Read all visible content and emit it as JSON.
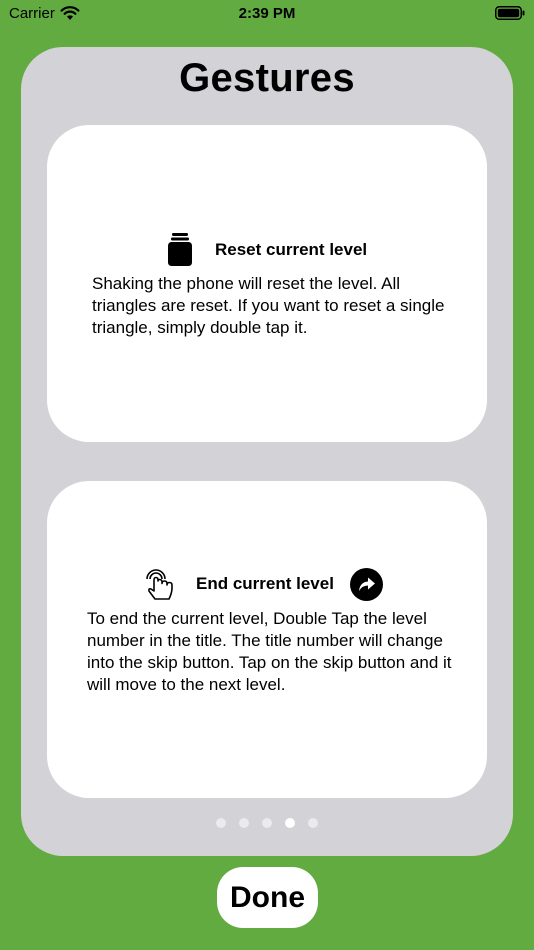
{
  "status_bar": {
    "carrier": "Carrier",
    "time": "2:39 PM"
  },
  "page": {
    "title": "Gestures"
  },
  "cards": [
    {
      "title": "Reset current level",
      "icon": "jar-icon",
      "text": "Shaking the phone will reset the level.  All triangles are reset. If you want to reset a single triangle, simply double tap it."
    },
    {
      "title": "End current level",
      "icon": "tap-hand-icon",
      "trailing_icon": "forward-arrow-icon",
      "text": "To end the current level, Double Tap the level number in the title.  The title number will change into the skip button. Tap on the skip button and it will move to the next level."
    }
  ],
  "pager": {
    "count": 5,
    "current": 4
  },
  "done_button": {
    "label": "Done"
  },
  "colors": {
    "background": "#62ab41",
    "panel": "#d2d2d7",
    "card": "#ffffff"
  }
}
